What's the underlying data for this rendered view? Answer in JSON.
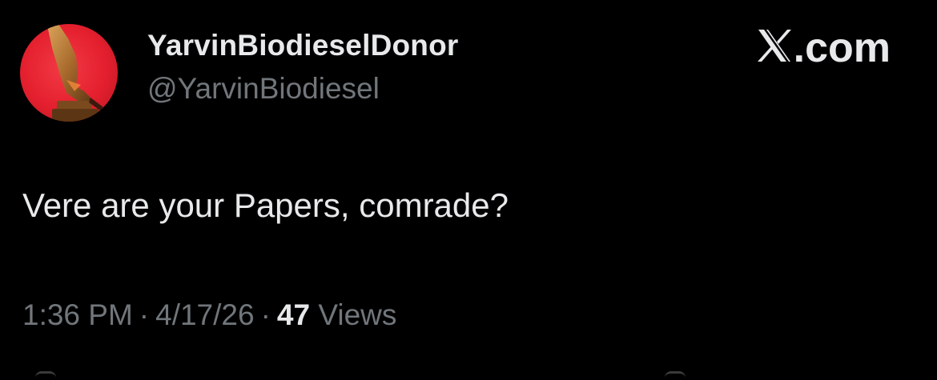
{
  "tweet": {
    "display_name": "YarvinBiodieselDonor",
    "handle": "@YarvinBiodiesel",
    "text": "Vere are your Papers, comrade?",
    "time": "1:36 PM",
    "date": "4/17/26",
    "views_count": "47",
    "views_label": "Views",
    "separator": "·"
  },
  "brand": {
    "name": ".com",
    "icon": "x-logo-icon"
  },
  "avatar": {
    "icon": "award-statue-icon",
    "background": "#e41f2e"
  },
  "colors": {
    "background": "#000000",
    "primary_text": "#e7e9ea",
    "secondary_text": "#71767b"
  }
}
